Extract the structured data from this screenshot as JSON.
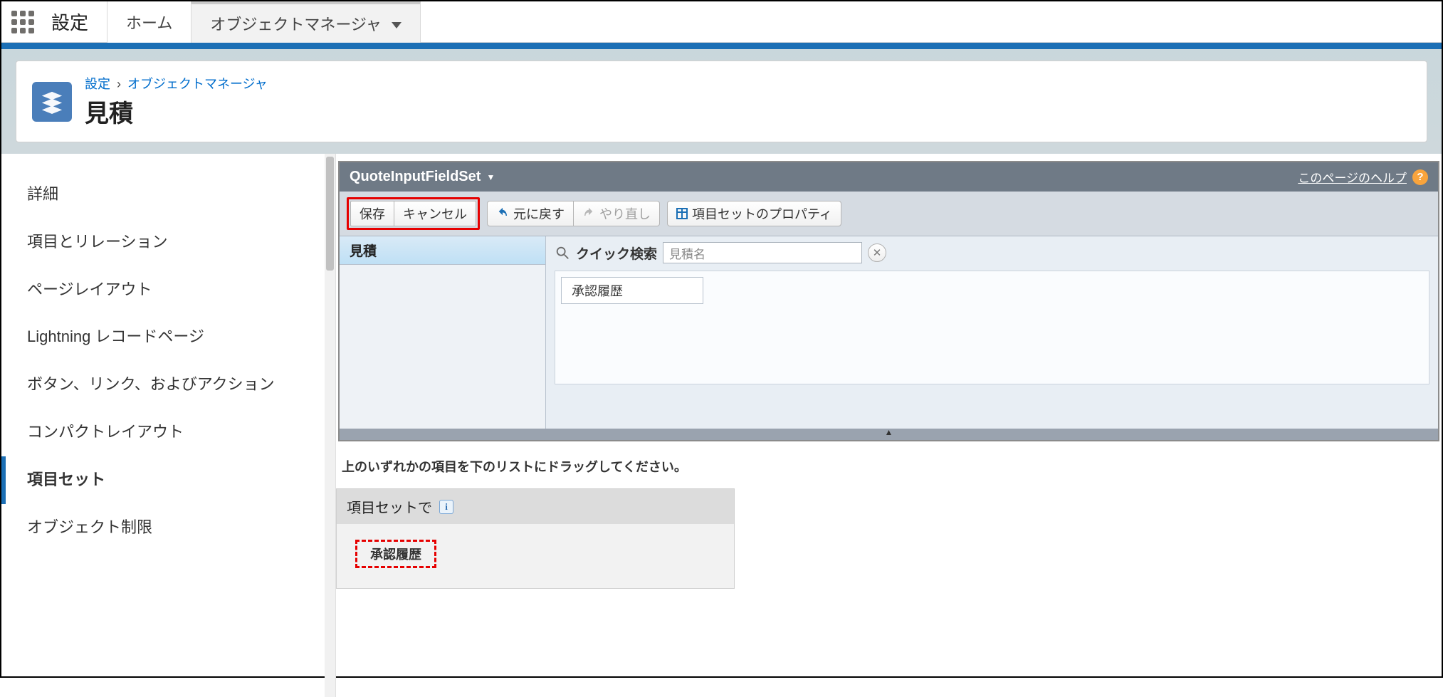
{
  "app": {
    "title": "設定"
  },
  "tabs": {
    "home": "ホーム",
    "obj_mgr": "オブジェクトマネージャ"
  },
  "breadcrumb": {
    "root": "設定",
    "section": "オブジェクトマネージャ"
  },
  "page": {
    "title": "見積"
  },
  "sidebar": {
    "items": [
      "詳細",
      "項目とリレーション",
      "ページレイアウト",
      "Lightning レコードページ",
      "ボタン、リンク、およびアクション",
      "コンパクトレイアウト",
      "項目セット",
      "オブジェクト制限"
    ],
    "active_index": 6
  },
  "palette": {
    "title": "QuoteInputFieldSet",
    "help_link": "このページのヘルプ",
    "toolbar": {
      "save": "保存",
      "cancel": "キャンセル",
      "undo": "元に戻す",
      "redo": "やり直し",
      "props": "項目セットのプロパティ"
    },
    "category": "見積",
    "search": {
      "label": "クイック検索",
      "placeholder": "見積名"
    },
    "available_fields": [
      "承認履歴"
    ]
  },
  "instruction": "上のいずれかの項目を下のリストにドラッグしてください。",
  "dropzone": {
    "heading": "項目セットで",
    "fields": [
      "承認履歴"
    ]
  }
}
